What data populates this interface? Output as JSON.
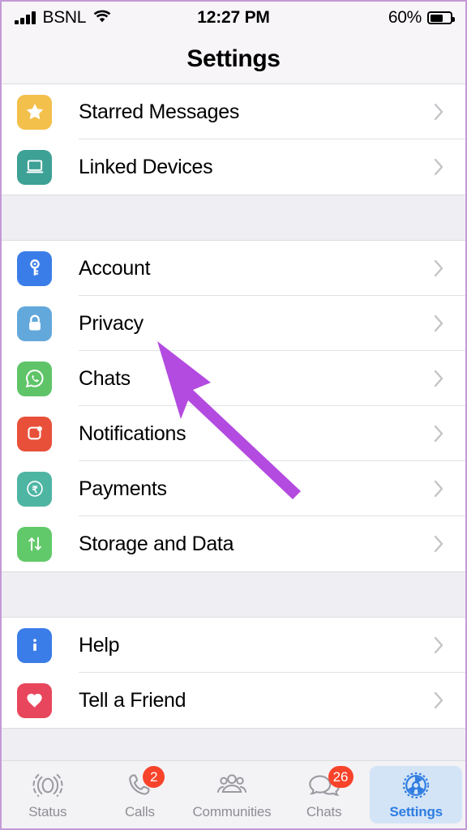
{
  "status_bar": {
    "carrier": "BSNL",
    "time": "12:27 PM",
    "battery_percent": "60%",
    "signal_icon": "cellular-signal-icon",
    "wifi_icon": "wifi-icon",
    "battery_icon": "battery-icon"
  },
  "nav": {
    "title": "Settings"
  },
  "groups": [
    {
      "items": [
        {
          "label": "Starred Messages",
          "icon": "star-icon",
          "color": "#f2c04b"
        },
        {
          "label": "Linked Devices",
          "icon": "laptop-icon",
          "color": "#3da196"
        }
      ]
    },
    {
      "items": [
        {
          "label": "Account",
          "icon": "key-icon",
          "color": "#3b7de8"
        },
        {
          "label": "Privacy",
          "icon": "lock-icon",
          "color": "#63a8db"
        },
        {
          "label": "Chats",
          "icon": "whatsapp-chat-icon",
          "color": "#5fc468"
        },
        {
          "label": "Notifications",
          "icon": "notification-bubble-icon",
          "color": "#e8503a"
        },
        {
          "label": "Payments",
          "icon": "rupee-icon",
          "color": "#4eb5a3"
        },
        {
          "label": "Storage and Data",
          "icon": "up-down-arrows-icon",
          "color": "#62c96a"
        }
      ]
    },
    {
      "items": [
        {
          "label": "Help",
          "icon": "info-icon",
          "color": "#3b7de8"
        },
        {
          "label": "Tell a Friend",
          "icon": "heart-icon",
          "color": "#e8465c"
        }
      ]
    }
  ],
  "chevron_icon": "chevron-right-icon",
  "tabs": [
    {
      "label": "Status",
      "icon": "status-rings-icon",
      "badge": "",
      "active": false
    },
    {
      "label": "Calls",
      "icon": "phone-icon",
      "badge": "2",
      "active": false
    },
    {
      "label": "Communities",
      "icon": "communities-icon",
      "badge": "",
      "active": false
    },
    {
      "label": "Chats",
      "icon": "chat-bubbles-icon",
      "badge": "26",
      "active": false
    },
    {
      "label": "Settings",
      "icon": "gear-icon",
      "badge": "",
      "active": true
    }
  ],
  "annotation": {
    "arrow_icon": "pointer-arrow-annotation",
    "color": "#b44be0",
    "points_to": "Privacy"
  },
  "colors": {
    "accent": "#2f7de1",
    "badge": "#f8432b",
    "separator": "#e2e2e5",
    "group_gap": "#efeff3",
    "chrome": "#f7f5f8"
  }
}
